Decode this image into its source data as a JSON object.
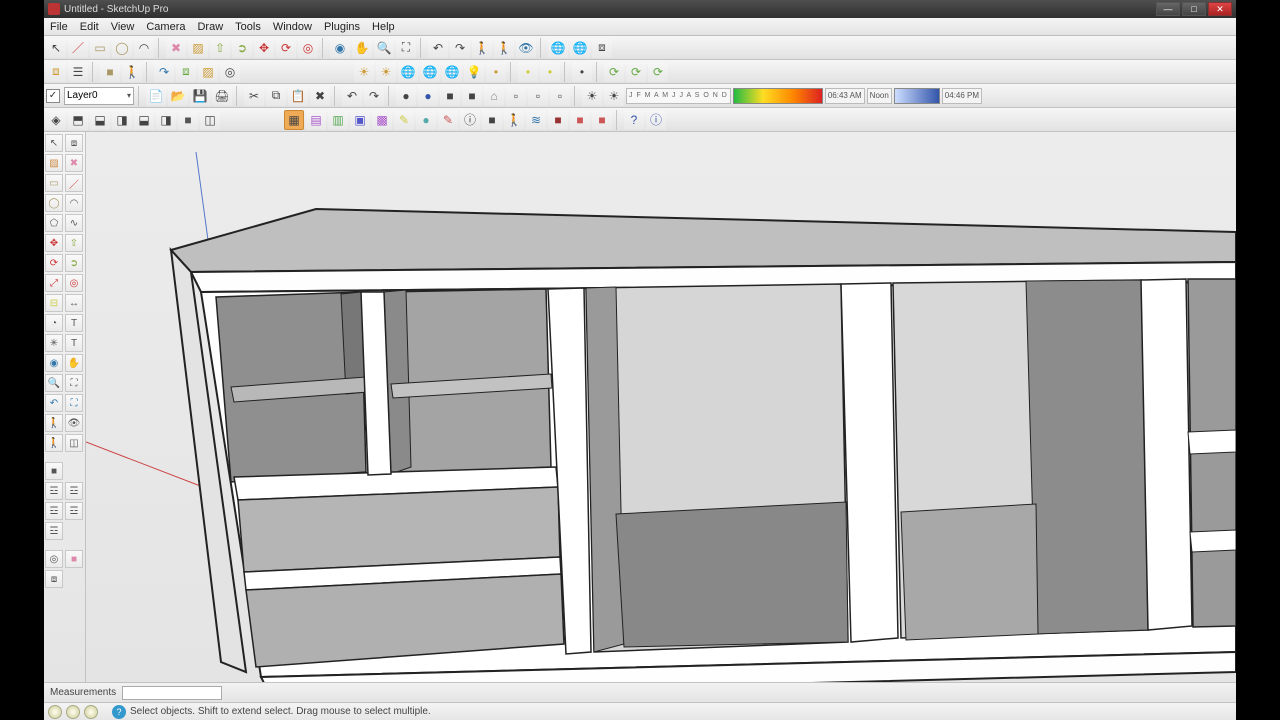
{
  "window": {
    "title": "Untitled - SketchUp Pro",
    "min": "—",
    "max": "□",
    "close": "✕"
  },
  "menu": {
    "file": "File",
    "edit": "Edit",
    "view": "View",
    "camera": "Camera",
    "draw": "Draw",
    "tools": "Tools",
    "window": "Window",
    "plugins": "Plugins",
    "help": "Help"
  },
  "layer": {
    "name": "Layer0",
    "checked": "✓"
  },
  "shadow": {
    "months": "J F M A M J J A S O N D",
    "time1": "06:43 AM",
    "noon": "Noon",
    "time2": "04:46 PM"
  },
  "measurements": {
    "label": "Measurements"
  },
  "status": {
    "hint": "Select objects. Shift to extend select. Drag mouse to select multiple."
  },
  "icons": {
    "select": "↖",
    "line": "／",
    "rect": "▭",
    "circle": "◯",
    "arc": "◠",
    "erase": "✖",
    "paint": "▨",
    "pushpull": "⇧",
    "move": "✥",
    "rotate": "⟳",
    "scale": "⤢",
    "tape": "⊟",
    "protractor": "◔",
    "text": "T",
    "dim": "↔",
    "axes": "✳",
    "orbit": "◉",
    "pan": "✋",
    "zoom": "🔍",
    "zoomext": "⛶",
    "prev": "↶",
    "next": "↷",
    "iso": "◈",
    "top": "⬒",
    "front": "⬓",
    "right": "◨",
    "outliner": "☰",
    "section": "◫",
    "walk": "🚶",
    "look": "👁",
    "shadow": "☀",
    "fog": "≋",
    "globe": "🌐",
    "sun": "☀",
    "bulb": "💡",
    "dot": "•",
    "new": "📄",
    "open": "📂",
    "save": "💾",
    "cut": "✂",
    "copy": "⧉",
    "paste": "📋",
    "undo": "↶",
    "redo": "↷",
    "print": "🖨",
    "sphere": "●",
    "box": "■",
    "layers": "☲",
    "comp": "⧈",
    "help": "?",
    "info": "ⓘ",
    "pencil": "✎",
    "poly": "⬠",
    "freehand": "∿",
    "offset": "◎",
    "follow": "➲",
    "xray": "▦",
    "wire": "▤",
    "hidden": "▥",
    "shaded": "▣",
    "tex": "▩",
    "mono": "▢",
    "home": "⌂",
    "page": "▫"
  }
}
